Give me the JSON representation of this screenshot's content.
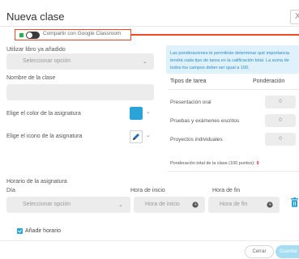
{
  "modal": {
    "title": "Nueva clase",
    "close_label": "X"
  },
  "google_classroom": {
    "label": "Compartir con Google Classroom",
    "enabled": false
  },
  "book": {
    "label": "Utilizar libro ya añadido",
    "placeholder": "Seleccionar opción"
  },
  "class_name": {
    "label": "Nombre de la clase",
    "value": ""
  },
  "color": {
    "label": "Elige el color de la asignatura",
    "value": "#29a3d8"
  },
  "icon": {
    "label": "Elige el icono de la asignatura",
    "icon_name": "pencil-icon"
  },
  "weights": {
    "info": "Las ponderaciones te permitirán determinar qué importancia tendrá cada tipo de tarea en la calificación total. La suma de todos los campos deber ser igual a 100.",
    "col_task": "Tipos de tarea",
    "col_weight": "Ponderación",
    "rows": [
      {
        "label": "Presentación oral",
        "value": "0"
      },
      {
        "label": "Pruebas y exámenes escritos",
        "value": "0"
      },
      {
        "label": "Proyectos individuales",
        "value": "0"
      }
    ],
    "total_label": "Ponderación total de la clase (100 puntos):",
    "total_value": "0"
  },
  "schedule": {
    "title": "Horario de la asignatura",
    "day_label": "Día",
    "day_placeholder": "Seleccionar opción",
    "start_label": "Hora de inicio",
    "start_placeholder": "Hora de inicio",
    "end_label": "Hora de fin",
    "end_placeholder": "Hora de fin",
    "add_label": "Añadir horario"
  },
  "footer": {
    "cancel_label": "Cerrar",
    "save_label": "Guardar"
  },
  "colors": {
    "accent": "#29a3d8",
    "highlight": "#f04a24",
    "save_disabled": "#a6ddf2",
    "success": "#22b24c"
  }
}
